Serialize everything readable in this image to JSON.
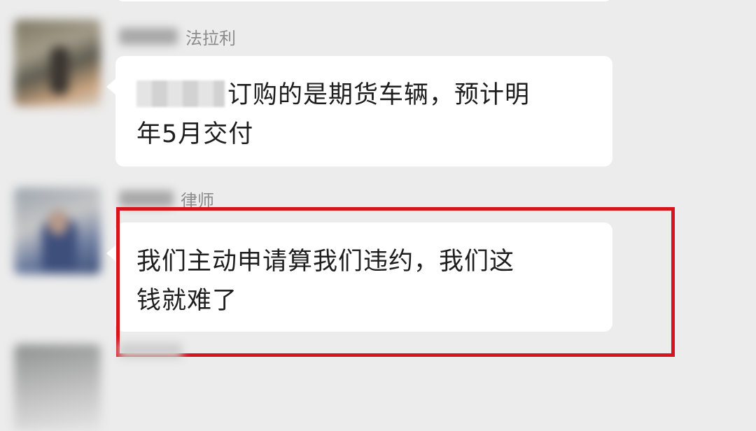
{
  "chat": {
    "messages": [
      {
        "sender_label": "法拉利",
        "text_line1": "订购的是期货车辆，预计明",
        "text_line2": "年5月交付"
      },
      {
        "sender_label": "律师",
        "text_line1": "我们主动申请算我们违约，我们这",
        "text_line2": "钱就难了"
      }
    ]
  },
  "colors": {
    "background": "#ececec",
    "bubble": "#ffffff",
    "highlight_border": "#d7141e",
    "sender_label": "#8c8c8c"
  }
}
